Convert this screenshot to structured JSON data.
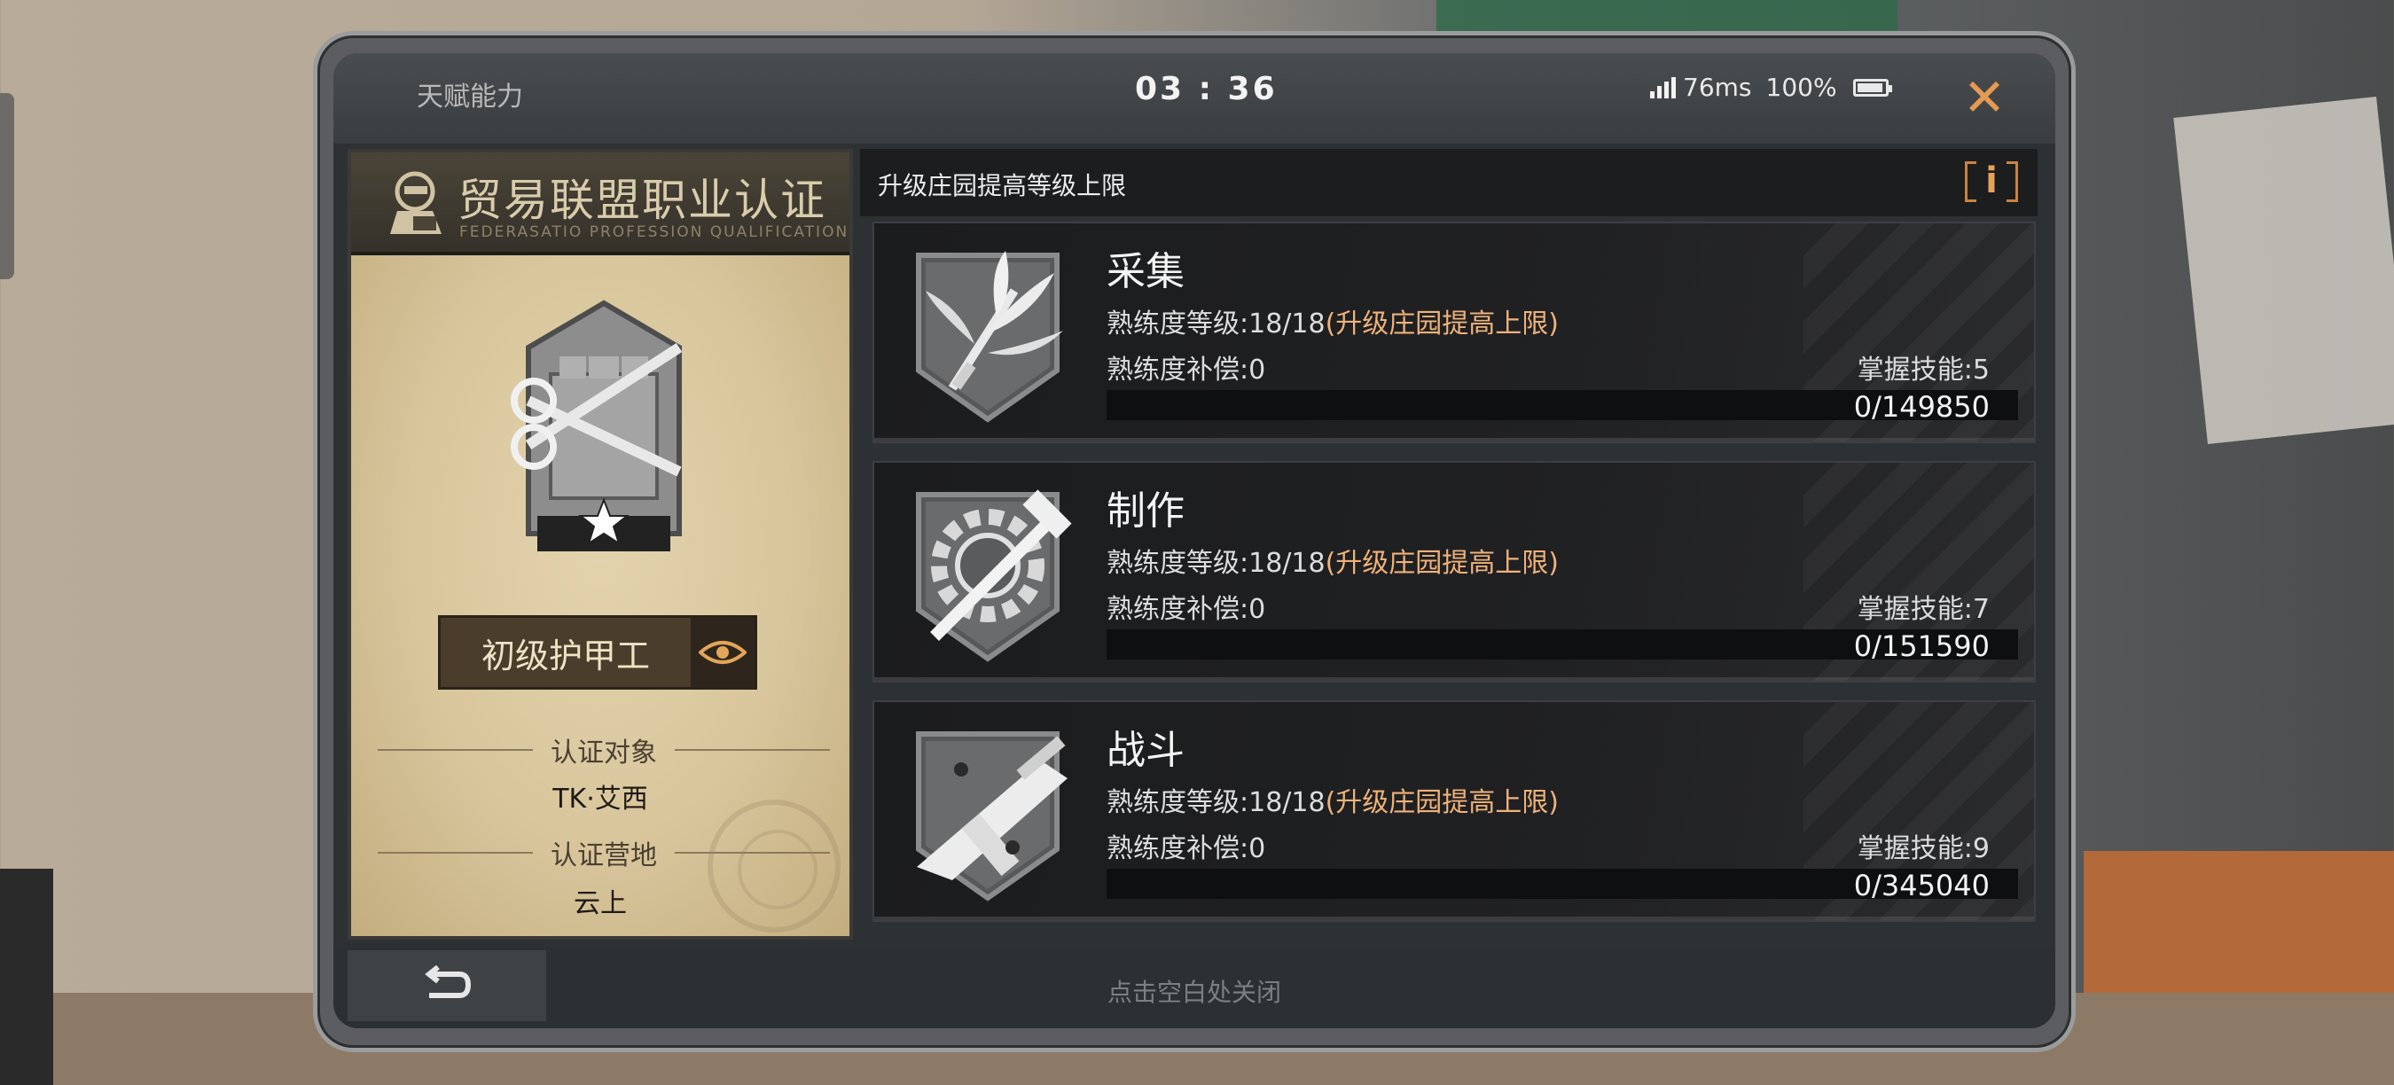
{
  "topbar": {
    "title": "天赋能力",
    "clock": "03 : 36",
    "ping": "76ms",
    "battery": "100%",
    "close_icon": "close-x-icon"
  },
  "certificate": {
    "title": "贸易联盟职业认证",
    "subtitle": "FEDERASATIO PROFESSION QUALIFICATION",
    "rank_name": "初级护甲工",
    "target_label": "认证对象",
    "target_value": "TK·艾西",
    "camp_label": "认证营地",
    "camp_value": "云上"
  },
  "panel": {
    "header": "升级庄园提高等级上限",
    "info_label": "i"
  },
  "skills": [
    {
      "name": "采集",
      "level_prefix": "熟练度等级:18/18",
      "level_note": "(升级庄园提高上限)",
      "compensation": "熟练度补偿:0",
      "mastery": "掌握技能:5",
      "progress_text": "0/149850",
      "progress_fraction": 0,
      "icon": "leaves-icon"
    },
    {
      "name": "制作",
      "level_prefix": "熟练度等级:18/18",
      "level_note": "(升级庄园提高上限)",
      "compensation": "熟练度补偿:0",
      "mastery": "掌握技能:7",
      "progress_text": "0/151590",
      "progress_fraction": 0,
      "icon": "hammer-gear-icon"
    },
    {
      "name": "战斗",
      "level_prefix": "熟练度等级:18/18",
      "level_note": "(升级庄园提高上限)",
      "compensation": "熟练度补偿:0",
      "mastery": "掌握技能:9",
      "progress_text": "0/345040",
      "progress_fraction": 0,
      "icon": "submachine-gun-icon"
    }
  ],
  "bottom": {
    "hint": "点击空白处关闭",
    "back_icon": "back-arrow-icon"
  },
  "colors": {
    "accent_orange": "#e49a52",
    "highlight_text": "#f0b27a",
    "parchment": "#d8c59b"
  }
}
